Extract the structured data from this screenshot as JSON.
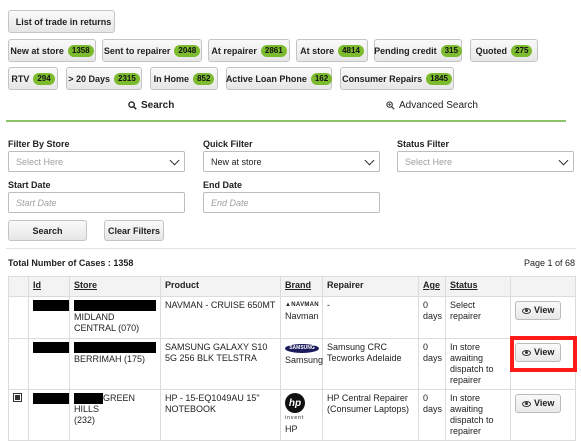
{
  "top_button": {
    "label": "List of trade in returns",
    "icon": "document-icon"
  },
  "filter_buttons_row1": [
    {
      "label": "New at store",
      "count": "1358"
    },
    {
      "label": "Sent to repairer",
      "count": "2048"
    },
    {
      "label": "At repairer",
      "count": "2861"
    },
    {
      "label": "At store",
      "count": "4814"
    },
    {
      "label": "Pending credit",
      "count": "315"
    },
    {
      "label": "Quoted",
      "count": "275"
    }
  ],
  "filter_buttons_row2": [
    {
      "label": "RTV",
      "count": "294"
    },
    {
      "label": "> 20 Days",
      "count": "2315"
    },
    {
      "label": "In Home",
      "count": "852"
    },
    {
      "label": "Active Loan Phone",
      "count": "162"
    },
    {
      "label": "Consumer Repairs",
      "count": "1845"
    }
  ],
  "tabs": {
    "search": "Search",
    "advanced": "Advanced Search"
  },
  "form": {
    "filter_by_store_label": "Filter By Store",
    "filter_by_store_placeholder": "Select Here",
    "quick_filter_label": "Quick Filter",
    "quick_filter_value": "New at store",
    "status_filter_label": "Status Filter",
    "status_filter_placeholder": "Select Here",
    "start_date_label": "Start Date",
    "start_date_placeholder": "Start Date",
    "end_date_label": "End Date",
    "end_date_placeholder": "End Date",
    "search_button": "Search",
    "clear_button": "Clear Filters"
  },
  "summary": {
    "total_label": "Total Number of Cases : 1358",
    "page_info": "Page 1 of 68"
  },
  "table": {
    "headers": {
      "id": "Id",
      "store": "Store",
      "product": "Product",
      "brand": "Brand",
      "repairer": "Repairer",
      "age": "Age",
      "status": "Status"
    },
    "rows": [
      {
        "store": "MIDLAND CENTRAL (070)",
        "product": "NAVMAN - CRUISE 650MT",
        "brand_logo": "NAVMAN",
        "brand": "Navman",
        "repairer": "-",
        "age": "0 days",
        "status": "Select repairer",
        "action": "View"
      },
      {
        "store": "BERRIMAH (175)",
        "product": "SAMSUNG GALAXY S10 5G 256 BLK TELSTRA",
        "brand_logo": "SAMSUNG",
        "brand": "Samsung",
        "repairer": "Samsung CRC Tecworks Adelaide",
        "age": "0 days",
        "status": "In store awaiting dispatch to repairer",
        "action": "View"
      },
      {
        "store_suffix": "GREEN HILLS",
        "store_tail": "(232)",
        "product": "HP - 15-EQ1049AU 15\" NOTEBOOK",
        "brand_logo": "hp",
        "brand_tagline": "invent",
        "brand": "HP",
        "repairer": "HP Central Repairer (Consumer Laptops)",
        "age": "0 days",
        "status": "In store awaiting dispatch to repairer",
        "action": "View"
      }
    ]
  },
  "colors": {
    "badge": "#7cba2e",
    "tab_underline": "#8fc36b",
    "highlight": "#ff1a1a"
  }
}
